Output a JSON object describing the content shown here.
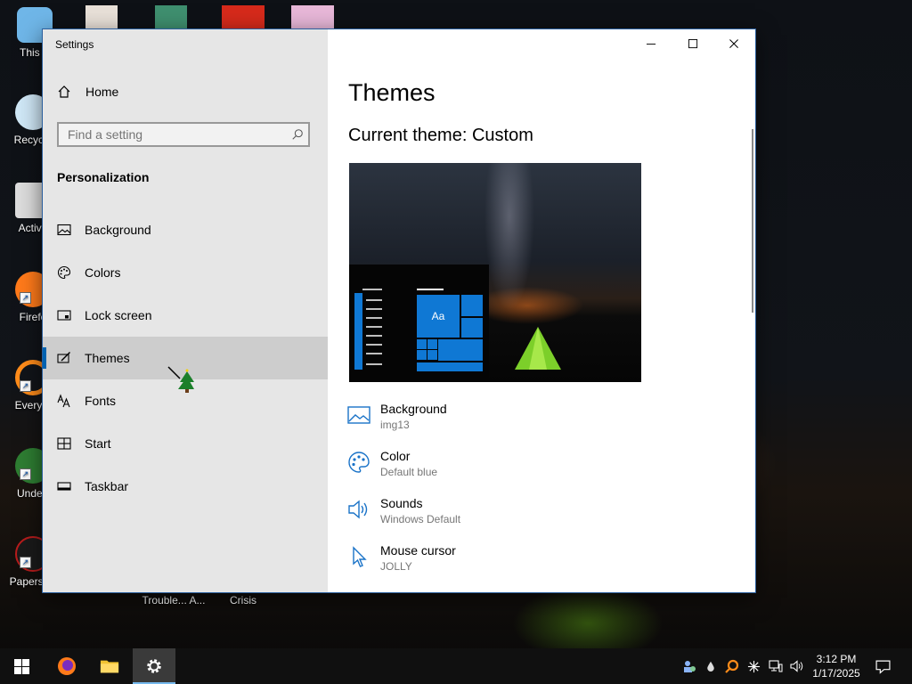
{
  "desktop": {
    "icons": [
      {
        "label": "This P",
        "color": "#6fb6e8"
      },
      {
        "label": "Recycle",
        "color": "#8fc4e8"
      },
      {
        "label": "Activa",
        "color": "#d8d8d8"
      },
      {
        "label": "Firefo",
        "color": "#ff7a1a"
      },
      {
        "label": "Everyth",
        "color": "#ff8c1a"
      },
      {
        "label": "Undert",
        "color": "#2e7d32"
      },
      {
        "label": "Papers, P",
        "color": "#b71c1c"
      }
    ],
    "bottom_labels": [
      "Trouble... A...",
      "Crisis"
    ]
  },
  "window": {
    "title": "Settings",
    "home_label": "Home",
    "search_placeholder": "Find a setting",
    "section_label": "Personalization",
    "nav": [
      {
        "label": "Background",
        "icon": "image-icon"
      },
      {
        "label": "Colors",
        "icon": "palette-icon"
      },
      {
        "label": "Lock screen",
        "icon": "lock-screen-icon"
      },
      {
        "label": "Themes",
        "icon": "themes-icon",
        "active": true
      },
      {
        "label": "Fonts",
        "icon": "fonts-icon"
      },
      {
        "label": "Start",
        "icon": "start-icon"
      },
      {
        "label": "Taskbar",
        "icon": "taskbar-icon"
      }
    ]
  },
  "content": {
    "title": "Themes",
    "current_theme": "Current theme: Custom",
    "preview_tile_text": "Aa",
    "properties": [
      {
        "name": "Background",
        "value": "img13",
        "icon": "image-icon"
      },
      {
        "name": "Color",
        "value": "Default blue",
        "icon": "palette-icon"
      },
      {
        "name": "Sounds",
        "value": "Windows Default",
        "icon": "speaker-icon"
      },
      {
        "name": "Mouse cursor",
        "value": "JOLLY",
        "icon": "cursor-icon"
      }
    ]
  },
  "taskbar": {
    "time": "3:12 PM",
    "date": "1/17/2025"
  },
  "colors": {
    "accent": "#0063b1",
    "tile_blue": "#0f78d4",
    "icon_blue": "#1a73c8"
  }
}
